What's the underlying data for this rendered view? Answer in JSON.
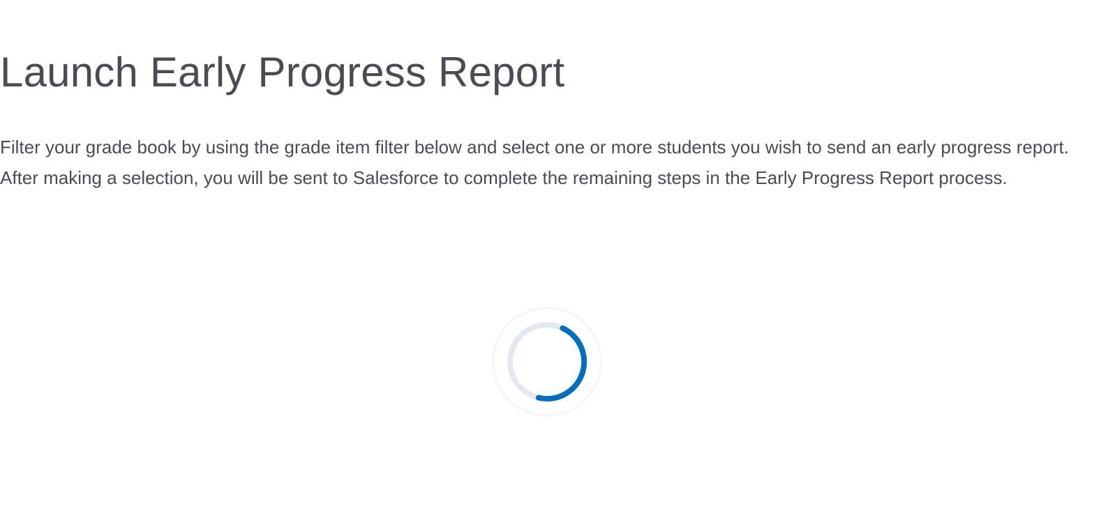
{
  "page": {
    "title": "Launch Early Progress Report",
    "description": "Filter your grade book by using the grade item filter below and select one or more students you wish to send an early progress report. After making a selection, you will be sent to Salesforce to complete the remaining steps in the Early Progress Report process."
  },
  "loading_indicator": {
    "icon": "loading-spinner-icon",
    "track_color": "#e3e9f1",
    "accent_color": "#006fbf"
  }
}
